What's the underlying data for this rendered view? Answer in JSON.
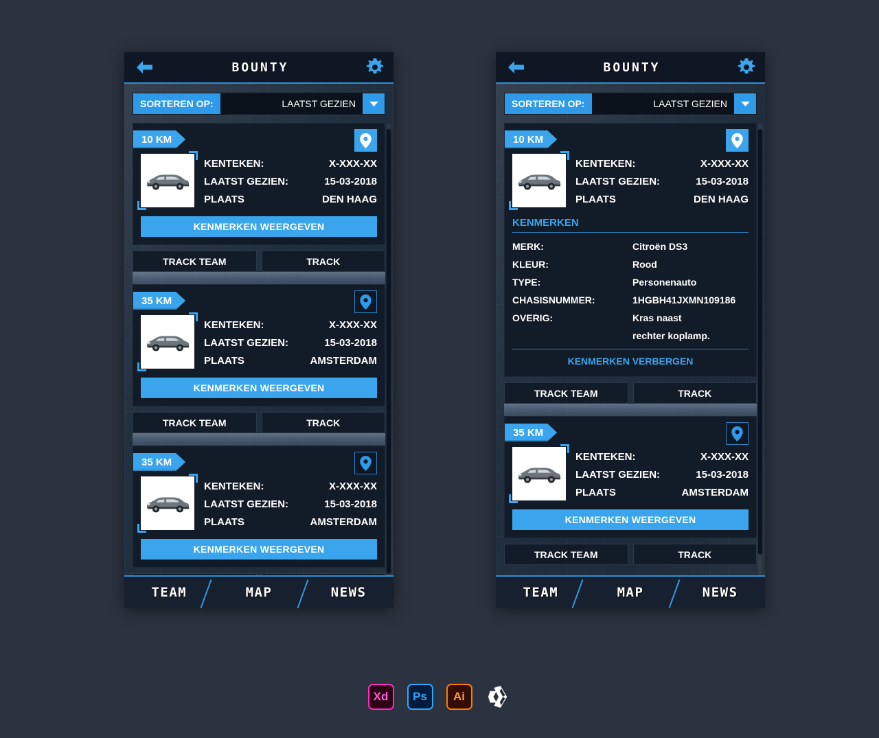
{
  "header": {
    "title": "BOUNTY",
    "back_icon": "back-arrow-icon",
    "settings_icon": "gear-icon"
  },
  "sort": {
    "label": "SORTEREN OP:",
    "value": "LAATST GEZIEN",
    "caret_icon": "chevron-down-icon"
  },
  "labels": {
    "kenteken": "KENTEKEN:",
    "laatst_gezien": "LAATST GEZIEN:",
    "plaats": "PLAATS",
    "show_features": "KENMERKEN WEERGEVEN",
    "hide_features": "KENMERKEN VERBERGEN",
    "features_title": "KENMERKEN",
    "track_team": "TRACK TEAM",
    "track": "TRACK"
  },
  "spec_labels": {
    "merk": "MERK:",
    "kleur": "KLEUR:",
    "type": "TYPE:",
    "chasisnummer": "CHASISNUMMER:",
    "overig": "OVERIG:"
  },
  "left_panel": {
    "cards": [
      {
        "distance": "10 KM",
        "pin_style": "filled",
        "kenteken": "X-XXX-XX",
        "laatst_gezien": "15-03-2018",
        "plaats": "DEN HAAG"
      },
      {
        "distance": "35 KM",
        "pin_style": "outline",
        "kenteken": "X-XXX-XX",
        "laatst_gezien": "15-03-2018",
        "plaats": "AMSTERDAM"
      },
      {
        "distance": "35 KM",
        "pin_style": "outline",
        "kenteken": "X-XXX-XX",
        "laatst_gezien": "15-03-2018",
        "plaats": "AMSTERDAM"
      }
    ]
  },
  "right_panel": {
    "cards": [
      {
        "distance": "10 KM",
        "pin_style": "filled",
        "kenteken": "X-XXX-XX",
        "laatst_gezien": "15-03-2018",
        "plaats": "DEN HAAG",
        "expanded": true,
        "specs": {
          "merk": "Citroën DS3",
          "kleur": "Rood",
          "type": "Personenauto",
          "chasisnummer": "1HGBH41JXMN109186",
          "overig": "Kras naast\nrechter koplamp."
        }
      },
      {
        "distance": "35 KM",
        "pin_style": "outline",
        "kenteken": "X-XXX-XX",
        "laatst_gezien": "15-03-2018",
        "plaats": "AMSTERDAM",
        "expanded": false
      }
    ]
  },
  "bottom_nav": {
    "items": [
      "TEAM",
      "MAP",
      "NEWS"
    ]
  },
  "apps": [
    {
      "name": "adobe-xd",
      "label": "Xd"
    },
    {
      "name": "adobe-photoshop",
      "label": "Ps"
    },
    {
      "name": "adobe-illustrator",
      "label": "Ai"
    },
    {
      "name": "unity",
      "label": ""
    }
  ],
  "colors": {
    "accent": "#3aa5ec",
    "accent_dark": "#2e8fd6",
    "page_bg": "#2b3340",
    "card_bg": "#121b28",
    "header_bg": "#0f1724"
  }
}
